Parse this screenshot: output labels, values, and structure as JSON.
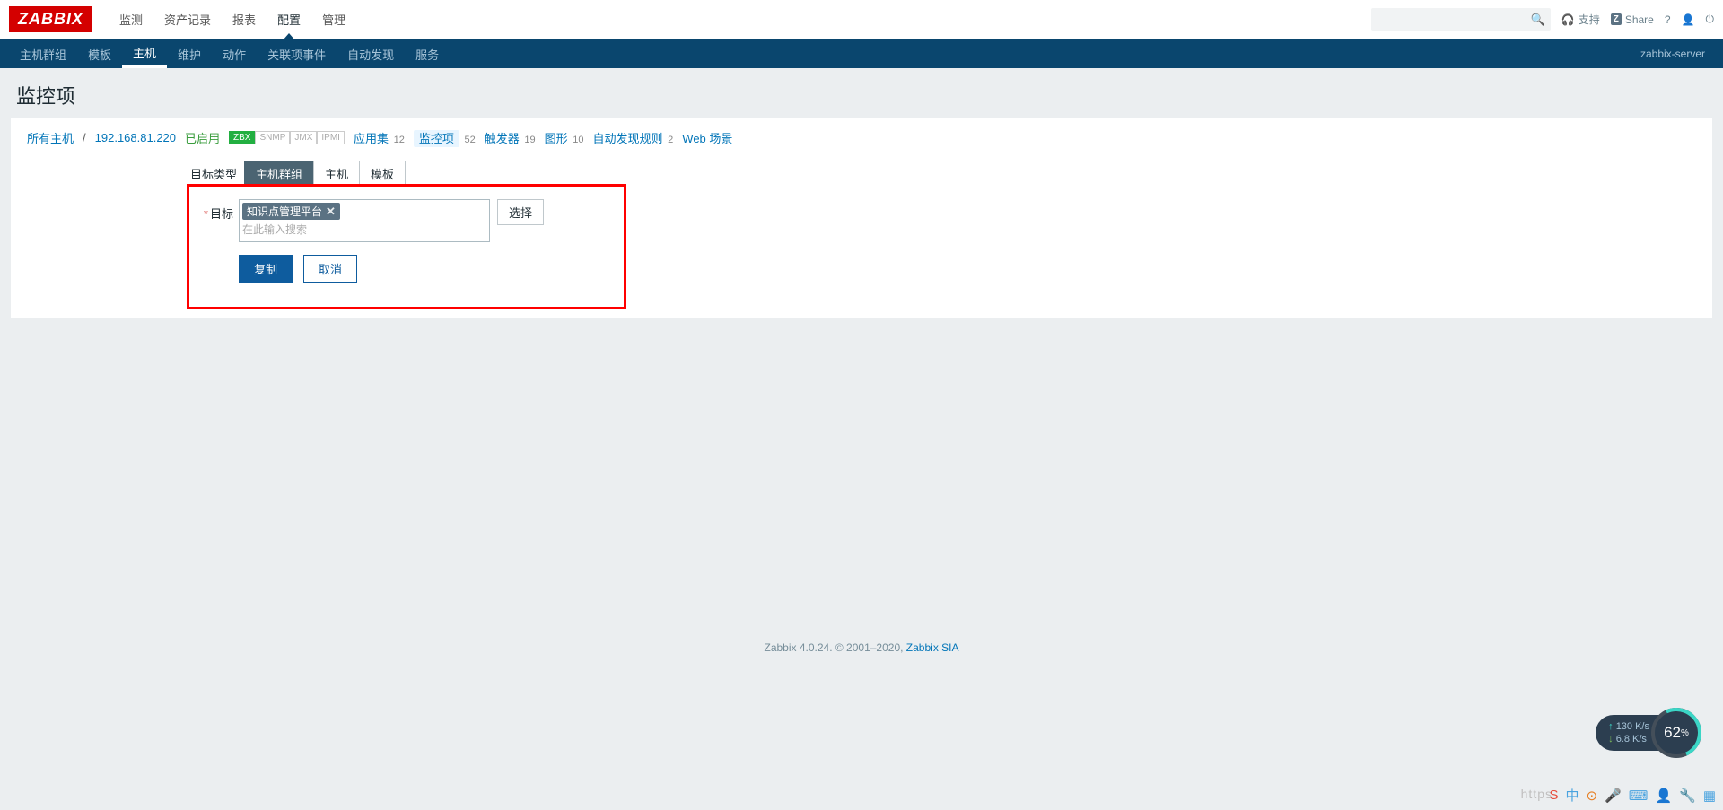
{
  "logo": "ZABBIX",
  "topnav": [
    "监测",
    "资产记录",
    "报表",
    "配置",
    "管理"
  ],
  "topnav_active_index": 3,
  "search_placeholder": "",
  "support_label": "支持",
  "share_label": "Share",
  "subnav": [
    "主机群组",
    "模板",
    "主机",
    "维护",
    "动作",
    "关联项事件",
    "自动发现",
    "服务"
  ],
  "subnav_active_index": 2,
  "server_name": "zabbix-server",
  "page_title": "监控项",
  "breadcrumb": {
    "all_hosts": "所有主机",
    "host_ip": "192.168.81.220",
    "status": "已启用",
    "protocols": [
      {
        "label": "ZBX",
        "active": true
      },
      {
        "label": "SNMP",
        "active": false
      },
      {
        "label": "JMX",
        "active": false
      },
      {
        "label": "IPMI",
        "active": false
      }
    ],
    "items": [
      {
        "label": "应用集",
        "count": "12",
        "active": false
      },
      {
        "label": "监控项",
        "count": "52",
        "active": true
      },
      {
        "label": "触发器",
        "count": "19",
        "active": false
      },
      {
        "label": "图形",
        "count": "10",
        "active": false
      },
      {
        "label": "自动发现规则",
        "count": "2",
        "active": false
      },
      {
        "label": "Web 场景",
        "count": "",
        "active": false
      }
    ]
  },
  "form": {
    "target_type_label": "目标类型",
    "target_type_options": [
      "主机群组",
      "主机",
      "模板"
    ],
    "target_type_active": 0,
    "target_label": "目标",
    "selected_tag": "知识点管理平台",
    "ms_placeholder": "在此输入搜索",
    "select_btn": "选择",
    "copy_btn": "复制",
    "cancel_btn": "取消"
  },
  "footer": {
    "text_prefix": "Zabbix 4.0.24. © 2001–2020, ",
    "link_text": "Zabbix SIA"
  },
  "perf": {
    "up": "130 K/s",
    "down": "6.8 K/s",
    "pct": "62",
    "pct_unit": "%"
  },
  "tray_labels": [
    "S",
    "中",
    "⊙",
    "🎤",
    "⌨",
    "👤",
    "🔧",
    "▦"
  ],
  "url_hint": "https"
}
